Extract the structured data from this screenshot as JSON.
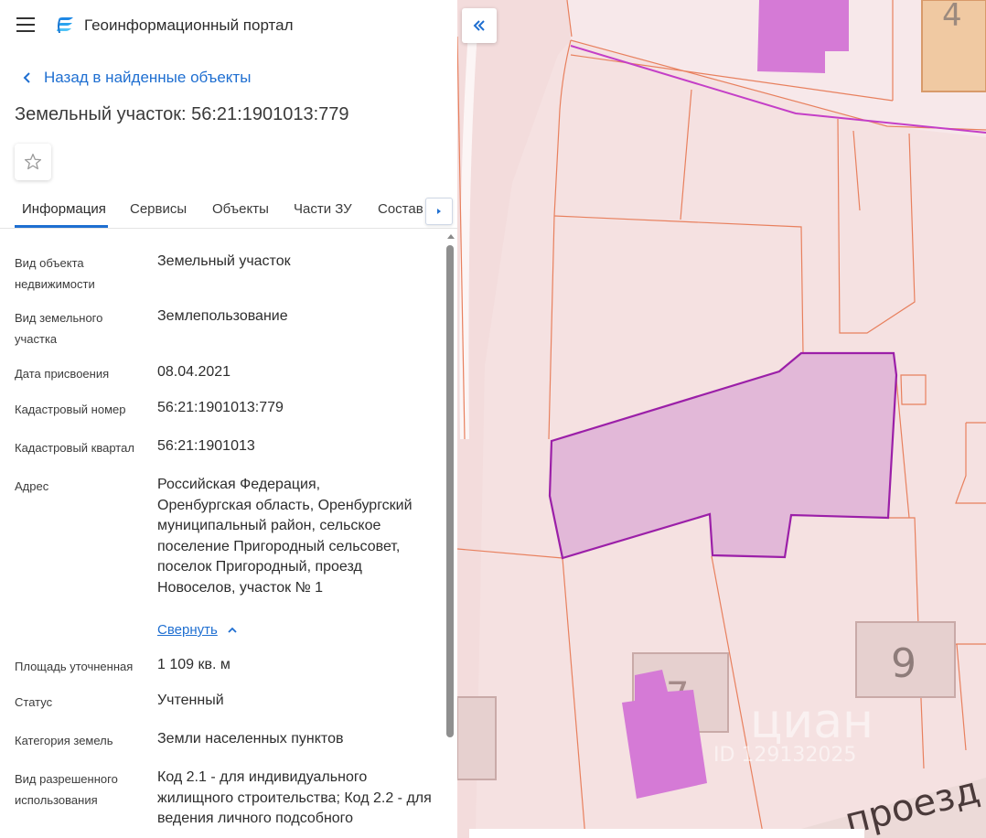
{
  "header": {
    "app_title": "Геоинформационный портал",
    "menu_icon": "hamburger-menu-icon",
    "logo_icon": "portal-logo-icon"
  },
  "navigation": {
    "back_label": "Назад в найденные объекты"
  },
  "object": {
    "title": "Земельный участок: 56:21:1901013:779",
    "favorite_icon": "star-icon"
  },
  "tabs": [
    {
      "label": "Информация",
      "active": true
    },
    {
      "label": "Сервисы",
      "active": false
    },
    {
      "label": "Объекты",
      "active": false
    },
    {
      "label": "Части ЗУ",
      "active": false
    },
    {
      "label": "Состав",
      "active": false
    }
  ],
  "properties": [
    {
      "label": "Вид объекта недвижимости",
      "value": "Земельный участок"
    },
    {
      "label": "Вид земельного участка",
      "value": "Землепользование"
    },
    {
      "label": "Дата присвоения",
      "value": "08.04.2021"
    },
    {
      "label": "Кадастровый номер",
      "value": "56:21:1901013:779"
    },
    {
      "label": "Кадастровый квартал",
      "value": "56:21:1901013"
    },
    {
      "label": "Адрес",
      "value": "Российская Федерация, Оренбургская область, Оренбургский муниципальный район, сельское поселение Пригородный сельсовет, поселок Пригородный, проезд Новоселов, участок № 1"
    },
    {
      "label": "Площадь уточненная",
      "value": "1 109 кв. м"
    },
    {
      "label": "Статус",
      "value": "Учтенный"
    },
    {
      "label": "Категория земель",
      "value": "Земли населенных пунктов"
    },
    {
      "label": "Вид разрешенного использования",
      "value": "Код 2.1 - для индивидуального жилищного строительства; Код 2.2 - для ведения личного подсобного"
    }
  ],
  "address_collapse_label": "Свернуть",
  "map": {
    "house_numbers": [
      "4",
      "7",
      "9"
    ],
    "street_label": "проезд",
    "watermark": "циан",
    "watermark_id": "ID 129132025",
    "colors": {
      "background": "#f5e1e1",
      "parcel_line": "#e8805e",
      "selected_fill": "#e2b8d8",
      "selected_stroke": "#9b1fa8",
      "building": "#d57ad6",
      "accent": "#1f6fd1"
    }
  }
}
